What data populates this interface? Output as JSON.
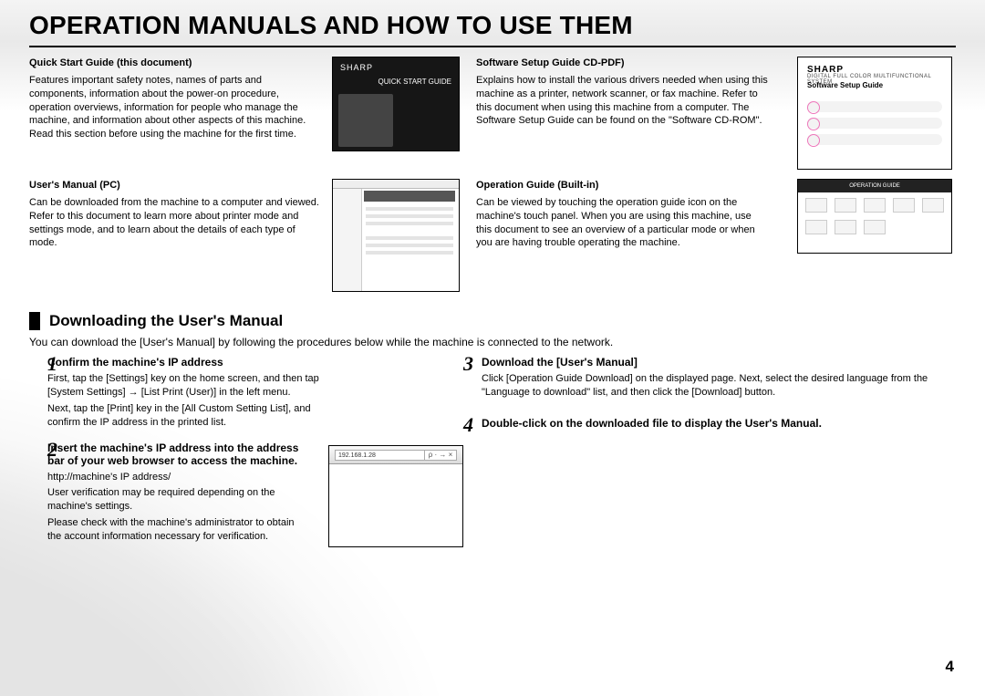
{
  "title": "OPERATION MANUALS AND HOW TO USE THEM",
  "page_number": "4",
  "manuals": {
    "quick_start": {
      "heading": "Quick Start Guide (this document)",
      "body1": "Features important safety notes, names of parts and components, information about the power-on procedure, operation overviews, information for people who manage the machine, and information about other aspects of this machine.",
      "body2": "Read this section before using the machine for the first time.",
      "preview_brand": "SHARP",
      "preview_label": "QUICK START GUIDE"
    },
    "users_manual_pc": {
      "heading": "User's Manual (PC)",
      "body1": "Can be downloaded from the machine to a computer and viewed. Refer to this document to learn more about printer mode and settings mode, and to learn about the details of each type of mode."
    },
    "software_setup": {
      "heading": "Software Setup Guide CD-PDF)",
      "body1": "Explains how to install the various drivers needed when using this machine as a printer, network scanner, or fax machine. Refer to this document when using this machine from a computer. The Software Setup Guide can be found on the \"Software CD-ROM\".",
      "preview_brand": "SHARP",
      "preview_caption": "DIGITAL FULL COLOR MULTIFUNCTIONAL SYSTEM",
      "preview_title": "Software Setup Guide"
    },
    "operation_guide": {
      "heading": "Operation Guide (Built-in)",
      "body1": "Can be viewed by touching the operation guide icon on the machine's touch panel. When you are using this machine, use this document to see an overview of a particular mode or when you are having trouble operating the machine.",
      "preview_bar": "OPERATION GUIDE"
    }
  },
  "download_section": {
    "heading": "Downloading the User's Manual",
    "intro": "You can download the [User's Manual] by following the procedures below while the machine is connected to the network.",
    "steps": [
      {
        "n": "1",
        "head": "Confirm the machine's IP address",
        "p1": "First, tap the [Settings] key on the home screen, and then tap [System Settings] → [List Print (User)] in the left menu.",
        "p2": "Next, tap the [Print] key in the [All Custom Setting List], and confirm the IP address in the printed list."
      },
      {
        "n": "2",
        "head": "Insert the machine's IP address into the address bar of your web browser to access the machine.",
        "p1": "http://machine's IP address/",
        "p2": "User verification may be required depending on the machine's settings.",
        "p3": "Please check with the machine's administrator to obtain the account information necessary for verification."
      },
      {
        "n": "3",
        "head": "Download the [User's Manual]",
        "p1": "Click [Operation Guide Download] on the displayed page. Next, select the desired language from the \"Language to download\" list, and then click the [Download] button."
      },
      {
        "n": "4",
        "head": "Double-click on the downloaded file to display the User's Manual."
      }
    ],
    "browser_address": "192.168.1.28",
    "browser_controls": "ρ  ·  →  ×"
  }
}
